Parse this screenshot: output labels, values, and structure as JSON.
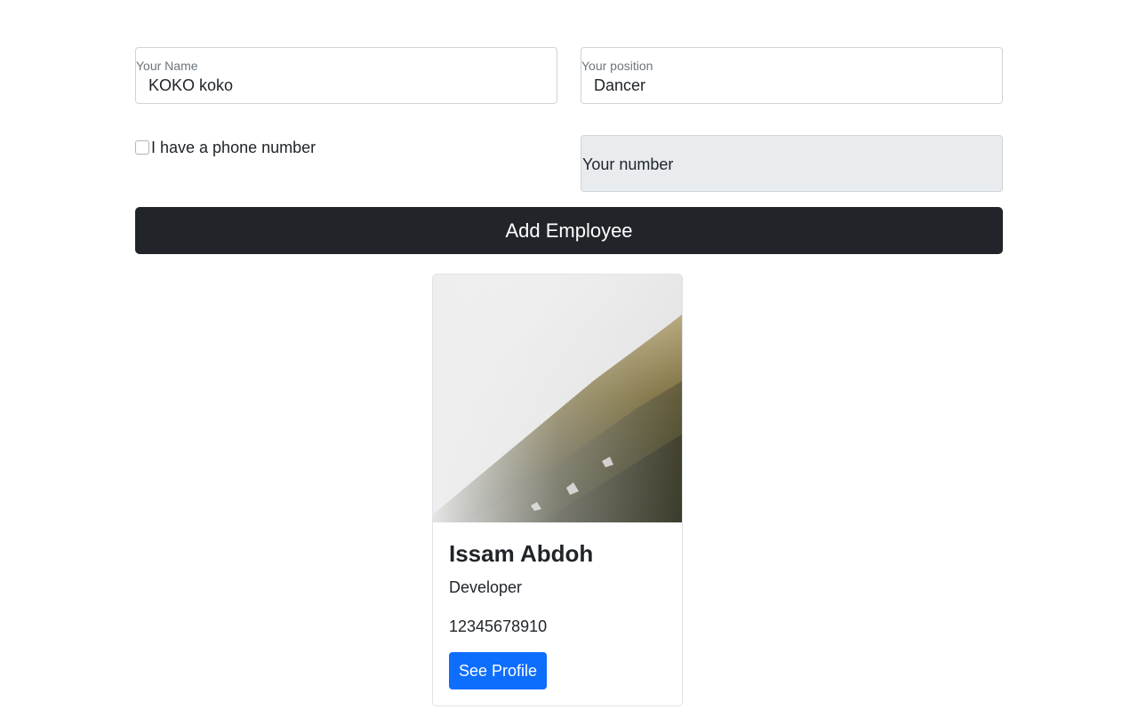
{
  "form": {
    "name": {
      "label": "Your Name",
      "value": "KOKO koko"
    },
    "position": {
      "label": "Your position",
      "value": "Dancer"
    },
    "phone_checkbox": {
      "label": "I have a phone number",
      "checked": false
    },
    "number": {
      "placeholder": "Your number"
    },
    "submit_label": "Add Employee"
  },
  "employees": [
    {
      "name": "Issam Abdoh",
      "position": "Developer",
      "phone": "12345678910",
      "button_label": "See Profile",
      "image": "foggy-forest-hillside"
    }
  ],
  "colors": {
    "primary": "#0d6efd",
    "dark": "#212529",
    "disabled_bg": "#e9ecef"
  }
}
